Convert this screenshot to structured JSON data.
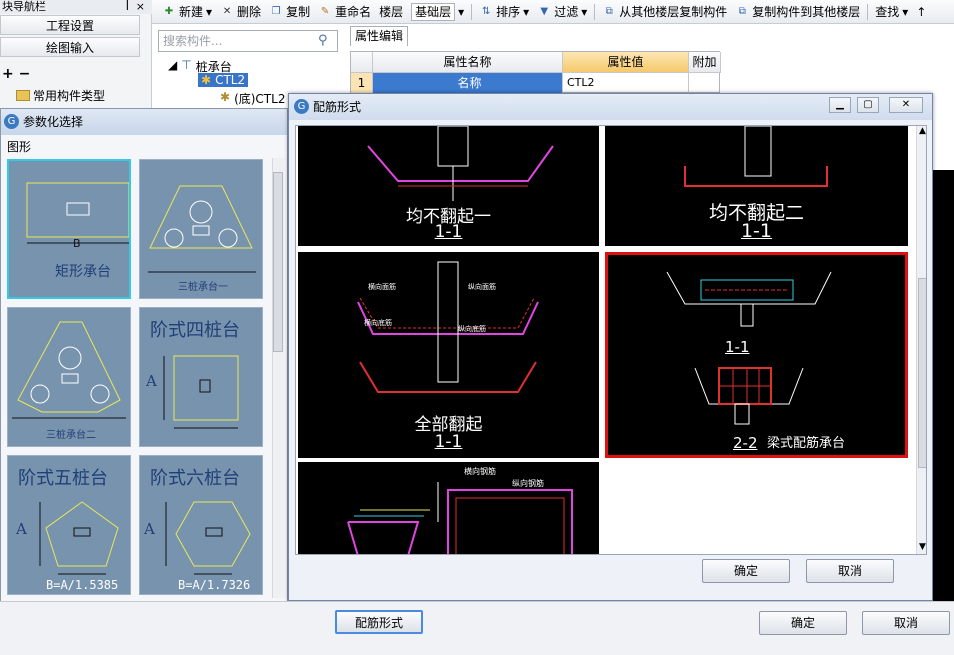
{
  "nav": {
    "title": "块导航栏",
    "project_settings": "工程设置",
    "drawing_input": "绘图输入",
    "pin": "ꟾ",
    "close": "×"
  },
  "toolbar": {
    "new": "新建",
    "delete": "删除",
    "copy": "复制",
    "rename": "重命名",
    "floor": "楼层",
    "floor_value": "基础层",
    "sort": "排序",
    "filter": "过滤",
    "copy_from_floor": "从其他楼层复制构件",
    "copy_to_floor": "复制构件到其他楼层",
    "find": "查找",
    "up": "↑"
  },
  "search": {
    "placeholder": "搜索构件..."
  },
  "tree": {
    "root": "桩承台",
    "child": "CTL2",
    "leaf": "(底)CTL2"
  },
  "components": {
    "common": "常用构件类型"
  },
  "props": {
    "tab": "属性编辑",
    "h_name": "属性名称",
    "h_value": "属性值",
    "h_extra": "附加",
    "row_no": "1",
    "row_name": "名称",
    "row_value": "CTL2"
  },
  "param": {
    "title": "参数化选择",
    "shape_label": "图形",
    "tiles": [
      {
        "name": "矩形承台",
        "dim": "B"
      },
      {
        "name": "三桩承台一"
      },
      {
        "name": "三桩承台二"
      },
      {
        "name": "阶式四桩台",
        "dim": "A"
      },
      {
        "name": "阶式五桩台",
        "dim": "A",
        "formula": "B=A/1.5385"
      },
      {
        "name": "阶式六桩台",
        "dim": "A",
        "formula": "B=A/1.7326"
      }
    ]
  },
  "dialog": {
    "title": "配筋形式",
    "panels": [
      {
        "caption": "均不翻起一",
        "section": "1-1"
      },
      {
        "caption": "均不翻起二",
        "section": "1-1"
      },
      {
        "caption": "全部翻起",
        "section": "1-1",
        "labels": [
          "横向面筋",
          "纵向面筋",
          "横向底筋",
          "纵向底筋"
        ]
      },
      {
        "caption": "梁式配筋承台",
        "section": "1-1",
        "section2": "2-2"
      },
      {
        "labels": [
          "横向钢筋",
          "纵向钢筋"
        ]
      }
    ],
    "ok": "确定",
    "cancel": "取消"
  },
  "bottom": {
    "rebar_form": "配筋形式",
    "ok": "确定",
    "cancel": "取消"
  }
}
